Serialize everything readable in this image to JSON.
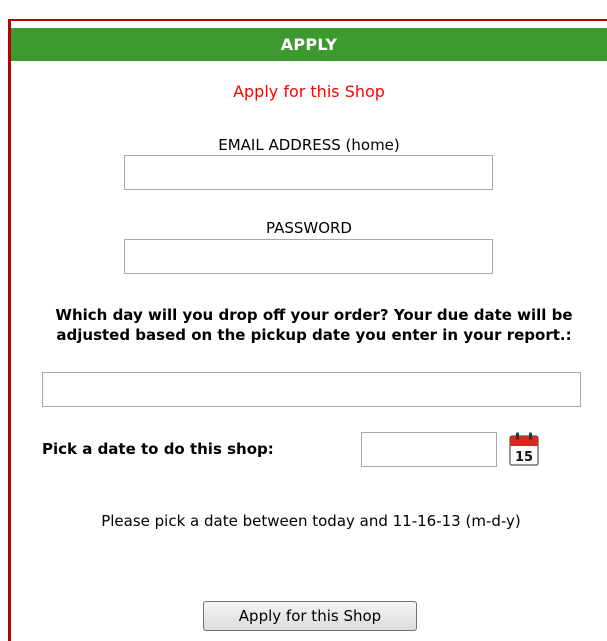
{
  "header": {
    "title": "APPLY"
  },
  "form": {
    "subtitle": "Apply for this Shop",
    "email_label": "EMAIL ADDRESS (home)",
    "email_value": "",
    "password_label": "PASSWORD",
    "password_value": "",
    "dropoff_question": "Which day will you drop off your order? Your due date will be adjusted based on the pickup date you enter in your report.:",
    "dropoff_value": "",
    "date_label": "Pick a date to do this shop:",
    "date_value": "",
    "calendar_day": "15",
    "date_hint": "Please pick a date between today and 11-16-13 (m-d-y)",
    "submit_label": "Apply for this Shop"
  },
  "colors": {
    "header_bg": "#3c9a2e",
    "frame_border": "#b30000",
    "subtitle_text": "#ff0000"
  },
  "icons": {
    "calendar": "calendar-icon"
  }
}
